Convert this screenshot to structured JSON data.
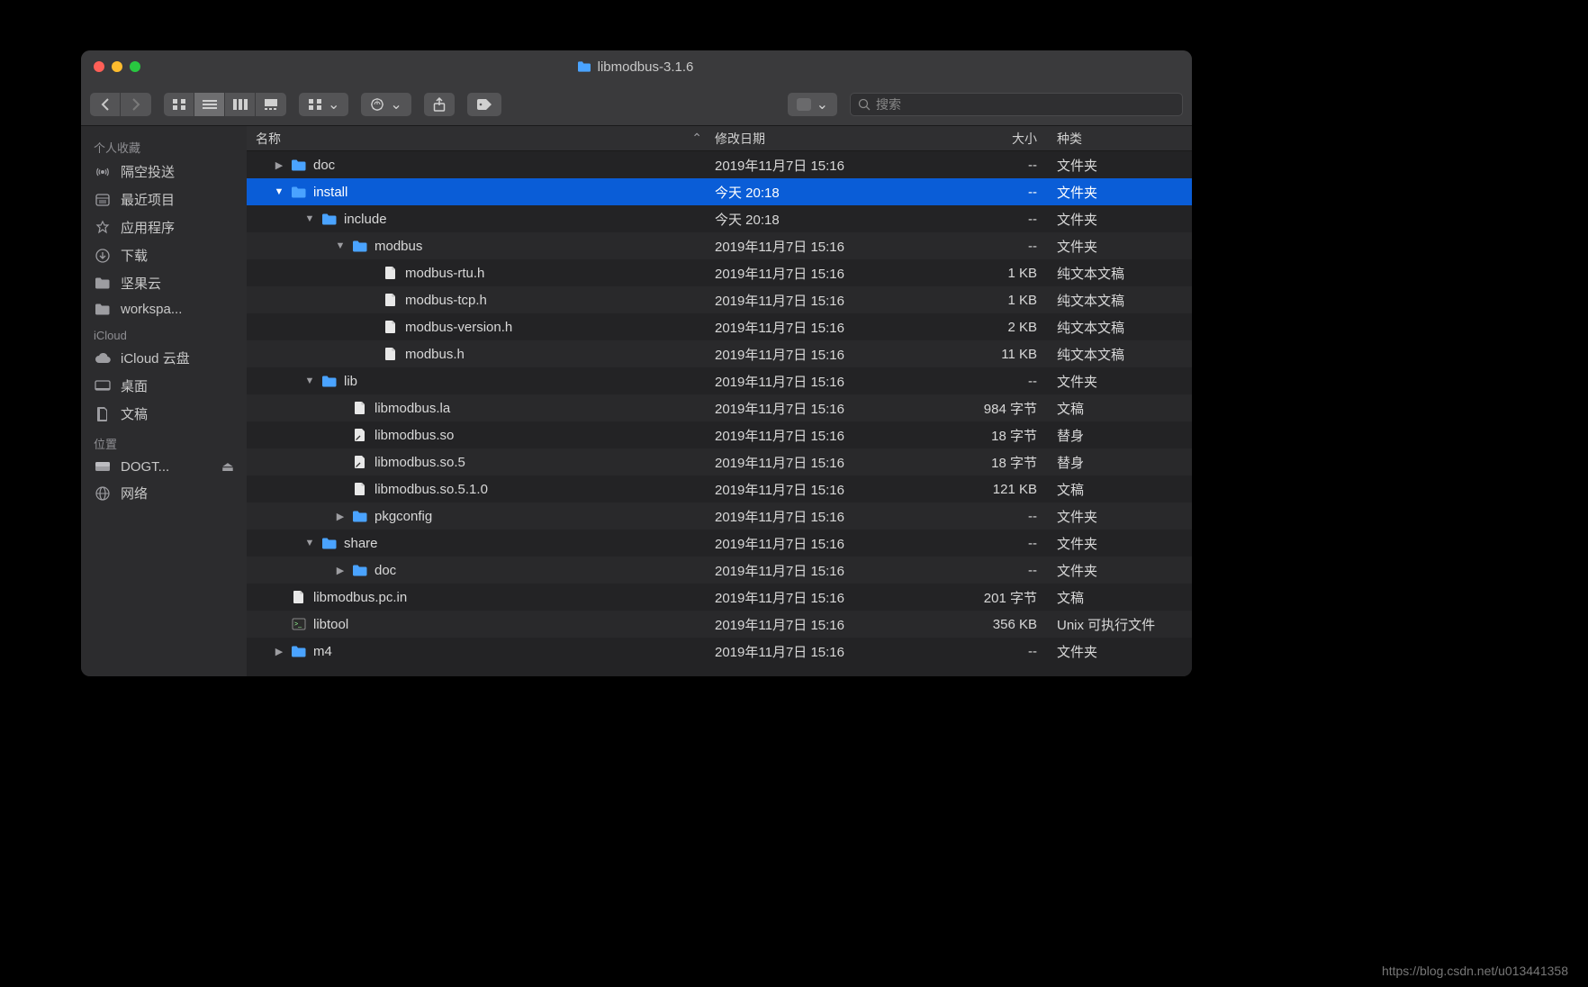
{
  "window": {
    "title": "libmodbus-3.1.6"
  },
  "toolbar": {
    "search_placeholder": "搜索"
  },
  "sidebar": {
    "sections": [
      {
        "header": "个人收藏",
        "items": [
          {
            "icon": "airdrop",
            "label": "隔空投送"
          },
          {
            "icon": "recents",
            "label": "最近项目"
          },
          {
            "icon": "apps",
            "label": "应用程序"
          },
          {
            "icon": "downloads",
            "label": "下载"
          },
          {
            "icon": "folder",
            "label": "坚果云"
          },
          {
            "icon": "folder",
            "label": "workspa..."
          }
        ]
      },
      {
        "header": "iCloud",
        "items": [
          {
            "icon": "cloud",
            "label": "iCloud 云盘"
          },
          {
            "icon": "desktop",
            "label": "桌面"
          },
          {
            "icon": "docs",
            "label": "文稿"
          }
        ]
      },
      {
        "header": "位置",
        "items": [
          {
            "icon": "disk",
            "label": "DOGT...",
            "eject": true
          },
          {
            "icon": "network",
            "label": "网络"
          }
        ]
      }
    ]
  },
  "columns": {
    "name": "名称",
    "date": "修改日期",
    "size": "大小",
    "kind": "种类"
  },
  "rows": [
    {
      "depth": 0,
      "disclosure": "right",
      "icon": "folder",
      "name": "doc",
      "date": "2019年11月7日 15:16",
      "size": "--",
      "kind": "文件夹",
      "selected": false
    },
    {
      "depth": 0,
      "disclosure": "down",
      "icon": "folder",
      "name": "install",
      "date": "今天 20:18",
      "size": "--",
      "kind": "文件夹",
      "selected": true
    },
    {
      "depth": 1,
      "disclosure": "down",
      "icon": "folder",
      "name": "include",
      "date": "今天 20:18",
      "size": "--",
      "kind": "文件夹",
      "selected": false
    },
    {
      "depth": 2,
      "disclosure": "down",
      "icon": "folder",
      "name": "modbus",
      "date": "2019年11月7日 15:16",
      "size": "--",
      "kind": "文件夹",
      "selected": false
    },
    {
      "depth": 3,
      "disclosure": "",
      "icon": "file",
      "name": "modbus-rtu.h",
      "date": "2019年11月7日 15:16",
      "size": "1 KB",
      "kind": "纯文本文稿",
      "selected": false
    },
    {
      "depth": 3,
      "disclosure": "",
      "icon": "file",
      "name": "modbus-tcp.h",
      "date": "2019年11月7日 15:16",
      "size": "1 KB",
      "kind": "纯文本文稿",
      "selected": false
    },
    {
      "depth": 3,
      "disclosure": "",
      "icon": "file",
      "name": "modbus-version.h",
      "date": "2019年11月7日 15:16",
      "size": "2 KB",
      "kind": "纯文本文稿",
      "selected": false
    },
    {
      "depth": 3,
      "disclosure": "",
      "icon": "file",
      "name": "modbus.h",
      "date": "2019年11月7日 15:16",
      "size": "11 KB",
      "kind": "纯文本文稿",
      "selected": false
    },
    {
      "depth": 1,
      "disclosure": "down",
      "icon": "folder",
      "name": "lib",
      "date": "2019年11月7日 15:16",
      "size": "--",
      "kind": "文件夹",
      "selected": false
    },
    {
      "depth": 2,
      "disclosure": "",
      "icon": "file",
      "name": "libmodbus.la",
      "date": "2019年11月7日 15:16",
      "size": "984 字节",
      "kind": "文稿",
      "selected": false
    },
    {
      "depth": 2,
      "disclosure": "",
      "icon": "alias",
      "name": "libmodbus.so",
      "date": "2019年11月7日 15:16",
      "size": "18 字节",
      "kind": "替身",
      "selected": false
    },
    {
      "depth": 2,
      "disclosure": "",
      "icon": "alias",
      "name": "libmodbus.so.5",
      "date": "2019年11月7日 15:16",
      "size": "18 字节",
      "kind": "替身",
      "selected": false
    },
    {
      "depth": 2,
      "disclosure": "",
      "icon": "file",
      "name": "libmodbus.so.5.1.0",
      "date": "2019年11月7日 15:16",
      "size": "121 KB",
      "kind": "文稿",
      "selected": false
    },
    {
      "depth": 2,
      "disclosure": "right",
      "icon": "folder",
      "name": "pkgconfig",
      "date": "2019年11月7日 15:16",
      "size": "--",
      "kind": "文件夹",
      "selected": false
    },
    {
      "depth": 1,
      "disclosure": "down",
      "icon": "folder",
      "name": "share",
      "date": "2019年11月7日 15:16",
      "size": "--",
      "kind": "文件夹",
      "selected": false
    },
    {
      "depth": 2,
      "disclosure": "right",
      "icon": "folder",
      "name": "doc",
      "date": "2019年11月7日 15:16",
      "size": "--",
      "kind": "文件夹",
      "selected": false
    },
    {
      "depth": 0,
      "disclosure": "",
      "icon": "file",
      "name": "libmodbus.pc.in",
      "date": "2019年11月7日 15:16",
      "size": "201 字节",
      "kind": "文稿",
      "selected": false
    },
    {
      "depth": 0,
      "disclosure": "",
      "icon": "exec",
      "name": "libtool",
      "date": "2019年11月7日 15:16",
      "size": "356 KB",
      "kind": "Unix 可执行文件",
      "selected": false
    },
    {
      "depth": 0,
      "disclosure": "right",
      "icon": "folder",
      "name": "m4",
      "date": "2019年11月7日 15:16",
      "size": "--",
      "kind": "文件夹",
      "selected": false
    }
  ],
  "watermark": "https://blog.csdn.net/u013441358"
}
